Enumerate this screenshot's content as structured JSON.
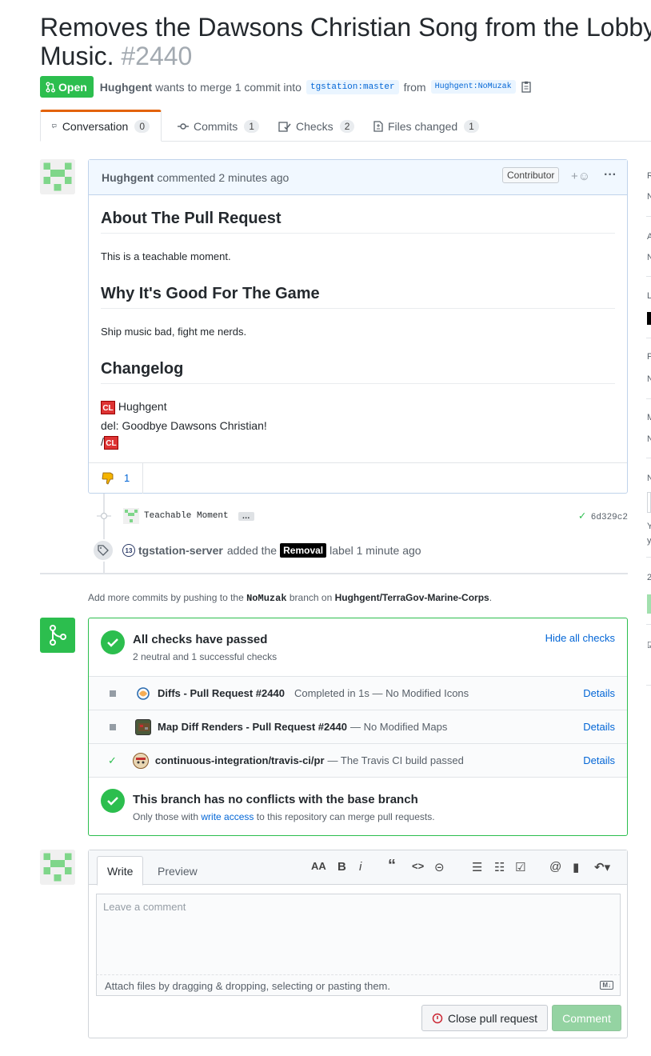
{
  "title": {
    "text": "Removes the Dawsons Christian Song from the Lobby Music.",
    "number": "#2440"
  },
  "meta": {
    "state": "Open",
    "author": "Hughgent",
    "wants_text": "wants to merge 1 commit into",
    "base_ref": "tgstation:master",
    "from_text": "from",
    "head_ref": "Hughgent:NoMuzak"
  },
  "tabs": [
    {
      "label": "Conversation",
      "count": "0"
    },
    {
      "label": "Commits",
      "count": "1"
    },
    {
      "label": "Checks",
      "count": "2"
    },
    {
      "label": "Files changed",
      "count": "1"
    }
  ],
  "comment": {
    "author": "Hughgent",
    "action": "commented 2 minutes ago",
    "role": "Contributor",
    "h1": "About The Pull Request",
    "p1": "This is a teachable moment.",
    "h2": "Why It's Good For The Game",
    "p2": "Ship music bad, fight me nerds.",
    "h3": "Changelog",
    "cl_badge": "CL",
    "cl_author": "Hughgent",
    "cl_line": "del: Goodbye Dawsons Christian!",
    "cl_close": "/",
    "reaction_count": "1"
  },
  "commit": {
    "message": "Teachable Moment",
    "ellipsis": "…",
    "sha": "6d329c2"
  },
  "event": {
    "actor": "tgstation-server",
    "text1": "added the",
    "label": "Removal",
    "text2": "label 1 minute ago"
  },
  "hint": {
    "t1": "Add more commits by pushing to the",
    "branch": "NoMuzak",
    "t2": "branch on",
    "repo": "Hughgent/TerraGov-Marine-Corps",
    "t3": "."
  },
  "merge": {
    "heading": "All checks have passed",
    "sub": "2 neutral and 1 successful checks",
    "hide": "Hide all checks",
    "checks": [
      {
        "name": "Diffs - Pull Request #2440",
        "desc": "Completed in 1s — No Modified Icons",
        "details": "Details"
      },
      {
        "name": "Map Diff Renders - Pull Request #2440",
        "desc": "— No Modified Maps",
        "details": "Details"
      },
      {
        "name": "continuous-integration/travis-ci/pr",
        "desc": "— The Travis CI build passed",
        "details": "Details"
      }
    ],
    "conflict_heading": "This branch has no conflicts with the base branch",
    "conflict_sub1": "Only those with",
    "conflict_link": "write access",
    "conflict_sub2": "to this repository can merge pull requests."
  },
  "editor": {
    "write_tab": "Write",
    "preview_tab": "Preview",
    "placeholder": "Leave a comment",
    "attach_text": "Attach files by dragging & dropping, selecting or pasting them.",
    "close_button": "Close pull request",
    "comment_button": "Comment"
  },
  "colors": {
    "green": "#2cbe4e",
    "link": "#0366d6",
    "orange": "#e36209"
  }
}
